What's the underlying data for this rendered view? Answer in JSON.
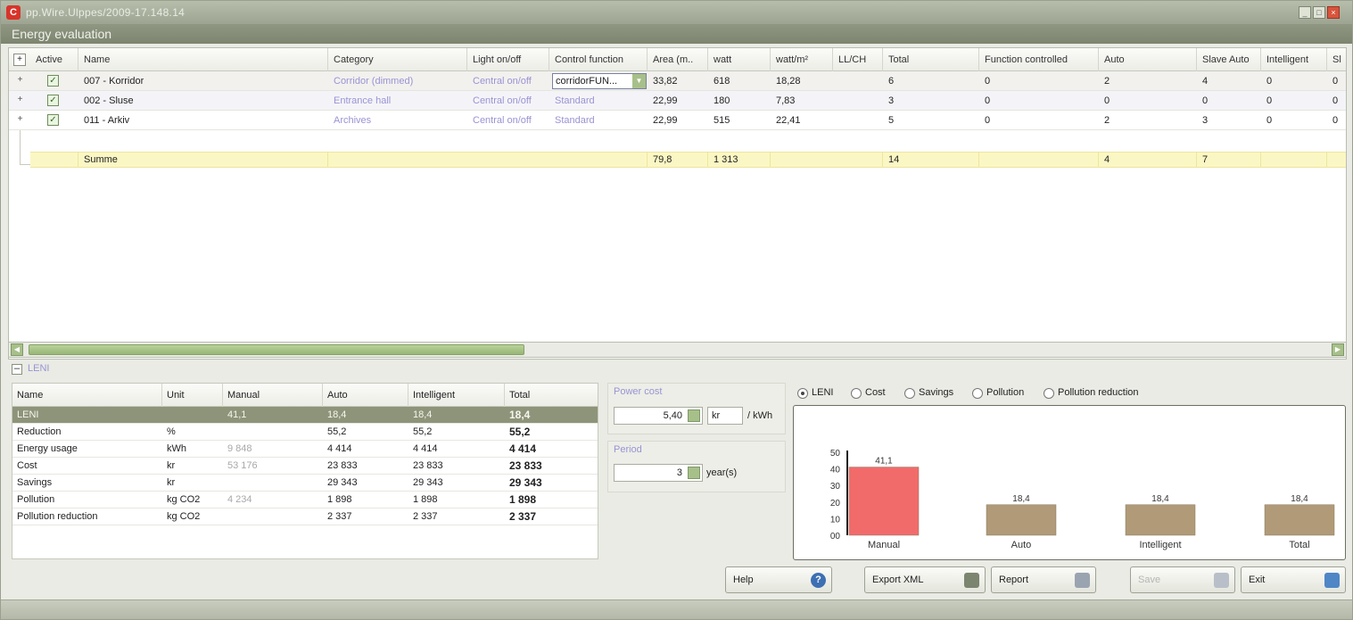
{
  "window": {
    "title": "pp.Wire.Ulppes/2009-17.148.14",
    "subtitle": "Energy evaluation"
  },
  "grid": {
    "expand_label": "+",
    "columns": [
      "Active",
      "Name",
      "Category",
      "Light on/off",
      "Control function",
      "Area (m..",
      "watt",
      "watt/m²",
      "LL/CH",
      "Total",
      "Function controlled",
      "Auto",
      "Slave Auto",
      "Intelligent",
      "Sl"
    ],
    "rows": [
      {
        "active": true,
        "name": "007 - Korridor",
        "category": "Corridor (dimmed)",
        "light": "Central on/off",
        "control": "corridorFUN...",
        "area": "33,82",
        "watt": "618",
        "wattm2": "18,28",
        "llch": "",
        "total": "6",
        "func": "0",
        "auto": "2",
        "slave": "4",
        "intel": "0",
        "sl": "0"
      },
      {
        "active": true,
        "name": "002 - Sluse",
        "category": "Entrance hall",
        "light": "Central on/off",
        "control": "Standard",
        "area": "22,99",
        "watt": "180",
        "wattm2": "7,83",
        "llch": "",
        "total": "3",
        "func": "0",
        "auto": "0",
        "slave": "0",
        "intel": "0",
        "sl": "0"
      },
      {
        "active": true,
        "name": "011 - Arkiv",
        "category": "Archives",
        "light": "Central on/off",
        "control": "Standard",
        "area": "22,99",
        "watt": "515",
        "wattm2": "22,41",
        "llch": "",
        "total": "5",
        "func": "0",
        "auto": "2",
        "slave": "3",
        "intel": "0",
        "sl": "0"
      }
    ],
    "sum": {
      "name": "Summe",
      "area": "79,8",
      "watt": "1 313",
      "total": "14",
      "auto": "4",
      "slave": "7"
    }
  },
  "leni": {
    "section_label": "LENI",
    "columns": [
      "Name",
      "Unit",
      "Manual",
      "Auto",
      "Intelligent",
      "Total"
    ],
    "rows": [
      {
        "name": "LENI",
        "unit": "",
        "manual": "41,1",
        "auto": "18,4",
        "intel": "18,4",
        "total": "18,4"
      },
      {
        "name": "Reduction",
        "unit": "%",
        "manual": "",
        "auto": "55,2",
        "intel": "55,2",
        "total": "55,2"
      },
      {
        "name": "Energy usage",
        "unit": "kWh",
        "manual": "9 848",
        "auto": "4 414",
        "intel": "4 414",
        "total": "4 414"
      },
      {
        "name": "Cost",
        "unit": "kr",
        "manual": "53 176",
        "auto": "23 833",
        "intel": "23 833",
        "total": "23 833"
      },
      {
        "name": "Savings",
        "unit": "kr",
        "manual": "",
        "auto": "29 343",
        "intel": "29 343",
        "total": "29 343"
      },
      {
        "name": "Pollution",
        "unit": "kg CO2",
        "manual": "4 234",
        "auto": "1 898",
        "intel": "1 898",
        "total": "1 898"
      },
      {
        "name": "Pollution reduction",
        "unit": "kg CO2",
        "manual": "",
        "auto": "2 337",
        "intel": "2 337",
        "total": "2 337"
      }
    ]
  },
  "power_cost": {
    "label": "Power cost",
    "value": "5,40",
    "currency": "kr",
    "unit": "/ kWh"
  },
  "period": {
    "label": "Period",
    "value": "3",
    "unit": "year(s)"
  },
  "chart_options": {
    "selected": "LENI",
    "items": [
      "LENI",
      "Cost",
      "Savings",
      "Pollution",
      "Pollution reduction"
    ]
  },
  "chart_data": {
    "type": "bar",
    "categories": [
      "Manual",
      "Auto",
      "Intelligent",
      "Total"
    ],
    "values": [
      41.1,
      18.4,
      18.4,
      18.4
    ],
    "value_labels": [
      "41,1",
      "18,4",
      "18,4",
      "18,4"
    ],
    "yticks": [
      "50",
      "40",
      "30",
      "20",
      "10",
      "00"
    ],
    "ylim": [
      0,
      50
    ],
    "colors": [
      "#f26b6b",
      "#b09a78",
      "#b09a78",
      "#b09a78"
    ],
    "title": "",
    "xlabel": "",
    "ylabel": "",
    "grid": false
  },
  "buttons": {
    "help": "Help",
    "export": "Export XML",
    "report": "Report",
    "save": "Save",
    "exit": "Exit"
  }
}
